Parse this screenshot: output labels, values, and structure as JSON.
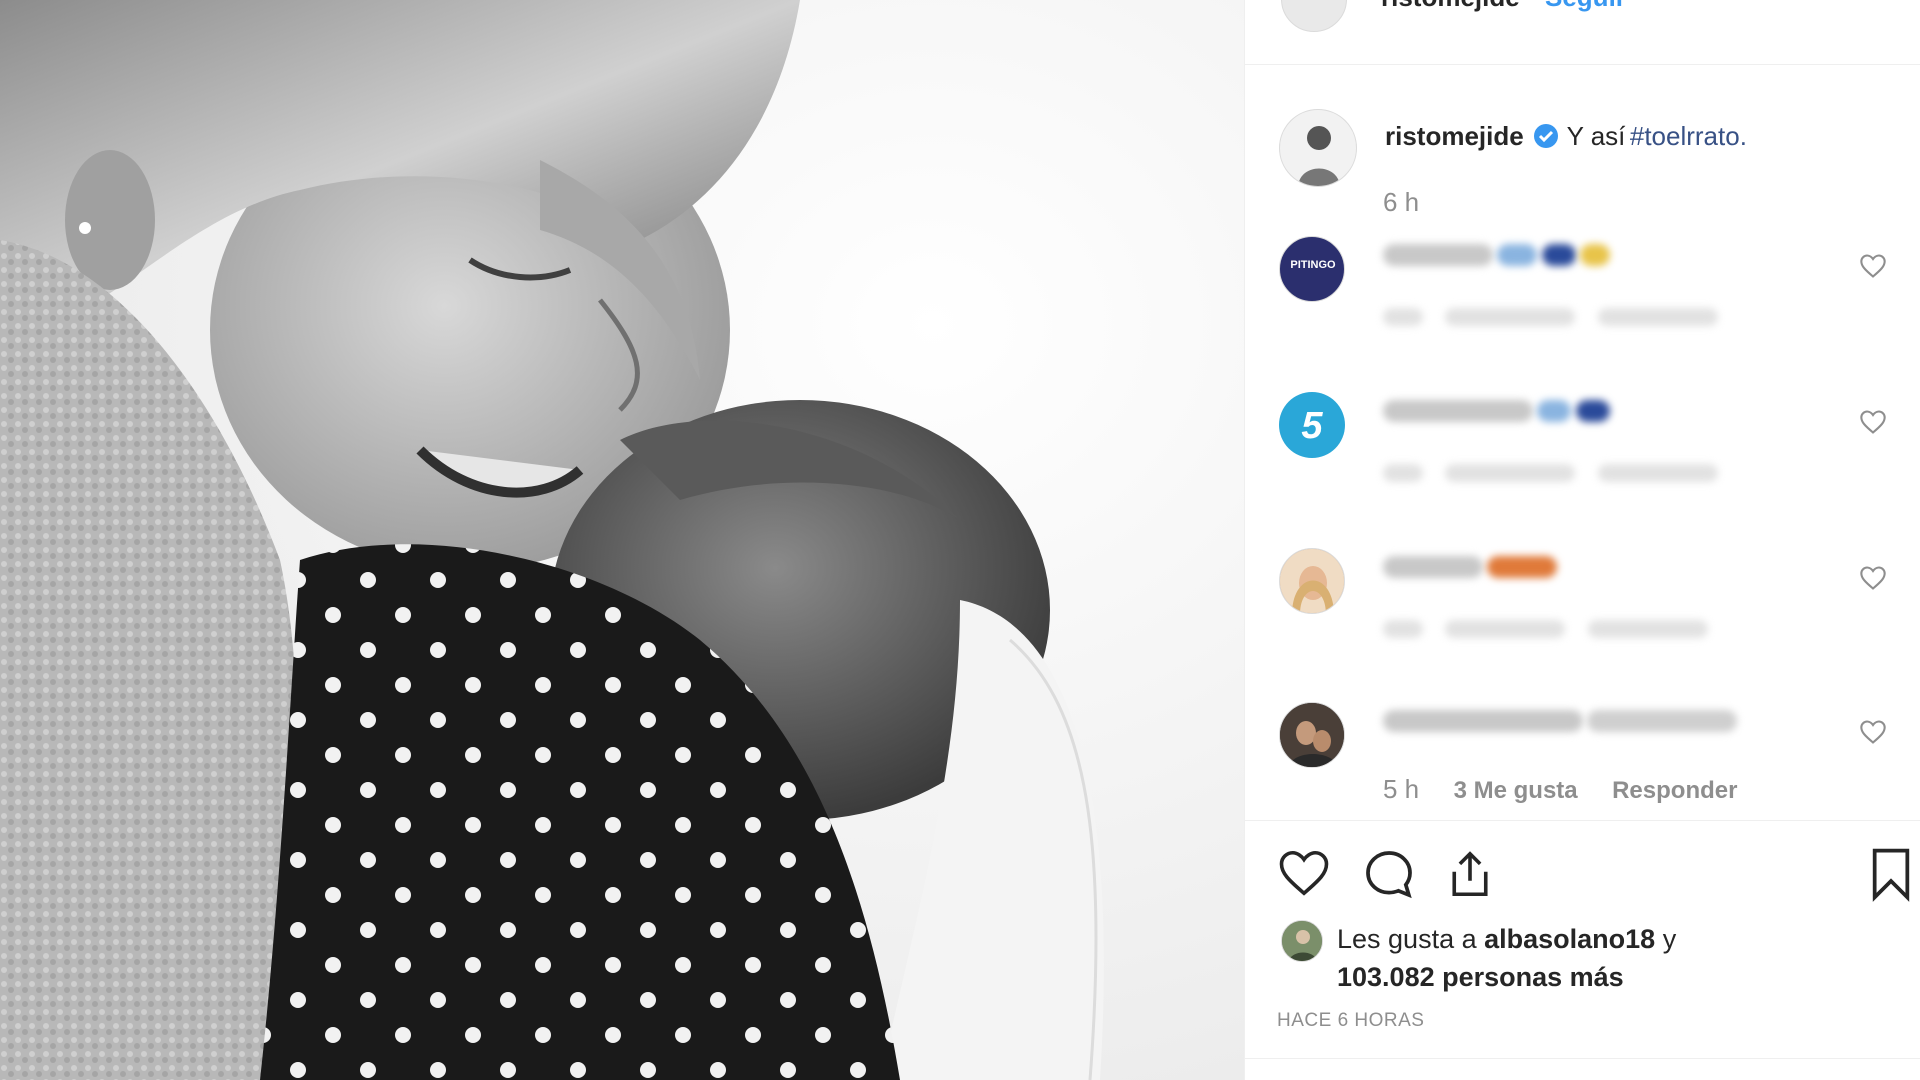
{
  "post": {
    "author": "ristomejide",
    "verified": true,
    "caption_text": "Y así",
    "caption_hashtag": "#toelrrato.",
    "caption_time": "6 h",
    "header_follow_label": "Seguir"
  },
  "comments": [
    {
      "avatar_label": "PITINGO",
      "avatar_color": "#2b2f6e"
    },
    {
      "avatar_label": "5",
      "avatar_color": "#2aa7d8"
    },
    {
      "avatar_color": "#d9b08c"
    },
    {
      "avatar_color": "#3b3b3b",
      "time": "5 h",
      "likes": "3 Me gusta",
      "reply": "Responder"
    }
  ],
  "actions": {
    "like_icon": "heart-icon",
    "comment_icon": "comment-bubble-icon",
    "share_icon": "share-icon",
    "save_icon": "bookmark-icon"
  },
  "likes": {
    "prefix": "Les gusta a",
    "user": "albasolano18",
    "conjunction": "y",
    "count": "103.082 personas más"
  },
  "timestamp": "HACE 6 HORAS",
  "colors": {
    "verified_blue": "#3897f0",
    "text": "#262626",
    "muted": "#8e8e8e",
    "hashtag": "#385185"
  }
}
